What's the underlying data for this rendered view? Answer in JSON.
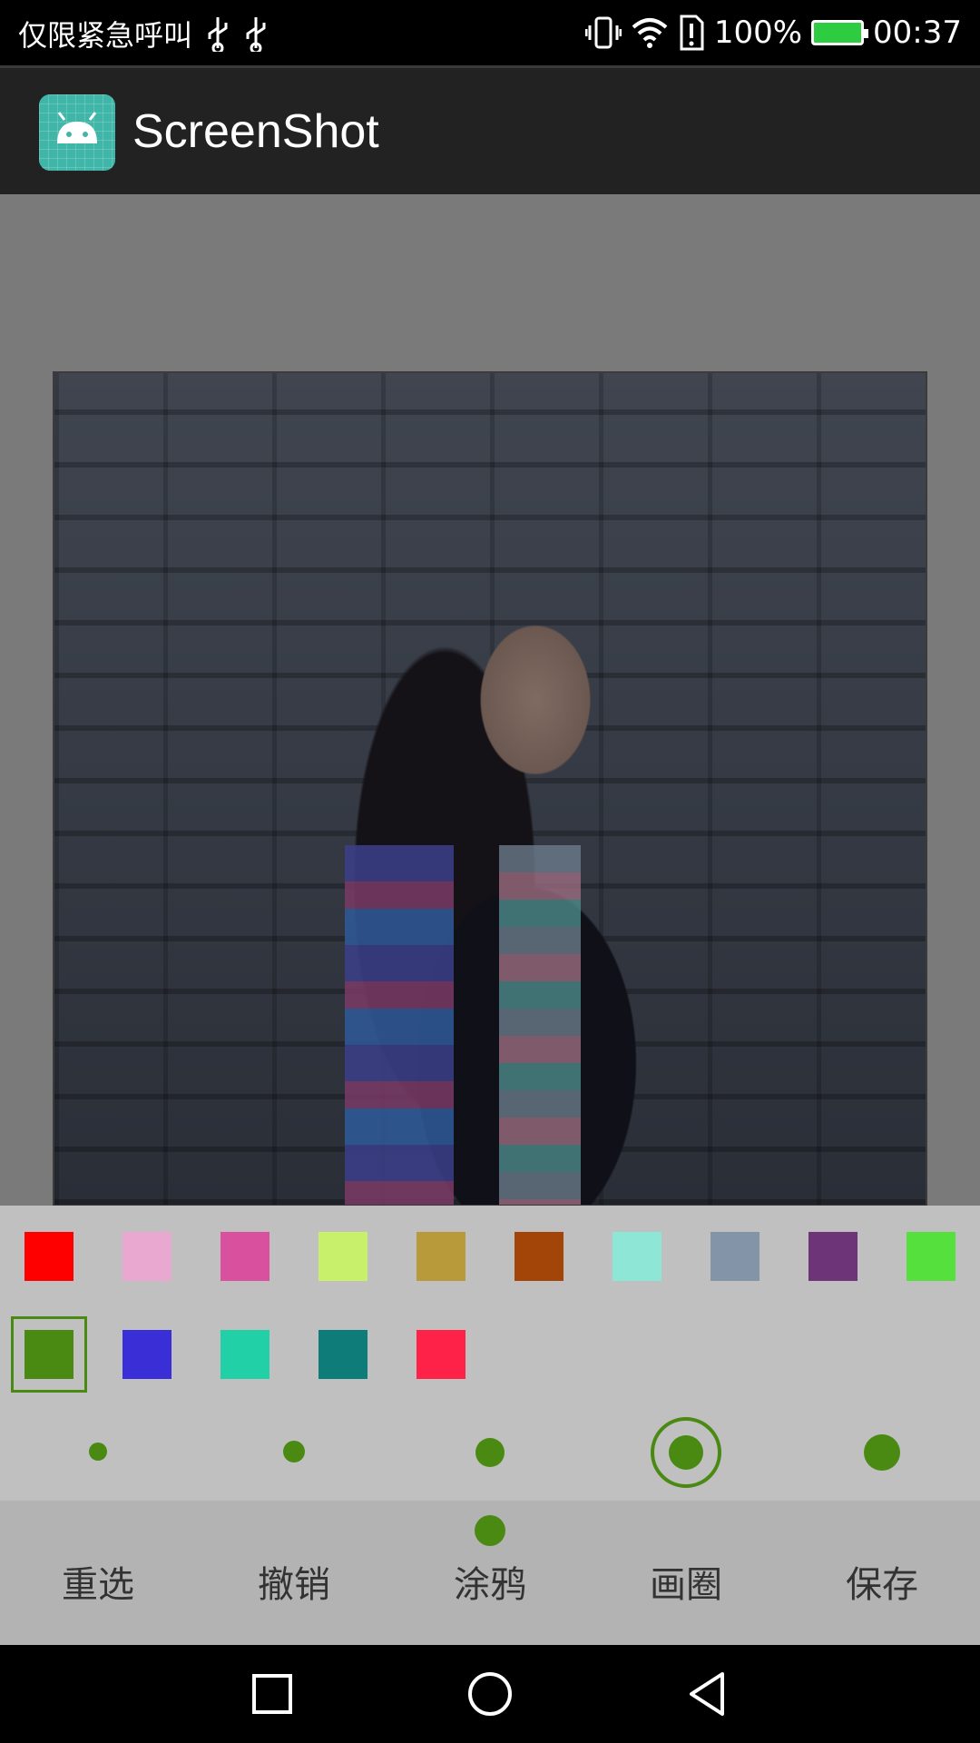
{
  "status_bar": {
    "carrier_text": "仅限紧急呼叫",
    "battery_percent": "100%",
    "time": "00:37",
    "icons": [
      "usb-icon",
      "usb-icon",
      "vibrate-icon",
      "wifi-icon",
      "sim-alert-icon",
      "battery-charging-icon"
    ]
  },
  "app_bar": {
    "title": "ScreenShot",
    "icon": "android-icon"
  },
  "palette": {
    "colors_row1": [
      "#ff0000",
      "#e8a8d0",
      "#d9519e",
      "#c8f06a",
      "#b89a3a",
      "#a34508",
      "#8ee6d6",
      "#8393a8",
      "#6e3478",
      "#55e03e"
    ],
    "colors_row2": [
      "#4a8a12",
      "#3a2ed6",
      "#22d0a8",
      "#0e7c78",
      "#ff2248"
    ],
    "selected_color": "#4a8a12",
    "brush_sizes": [
      "size-1",
      "size-2",
      "size-3",
      "size-4",
      "size-5"
    ],
    "selected_brush_size": "size-4"
  },
  "toolbar": {
    "tools": [
      "重选",
      "撤销",
      "涂鸦",
      "画圈",
      "保存"
    ],
    "active_tool": "涂鸦",
    "accent": "#4a8a12"
  },
  "nav_bar": {
    "icons": [
      "recent-apps-icon",
      "home-icon",
      "back-icon"
    ]
  }
}
